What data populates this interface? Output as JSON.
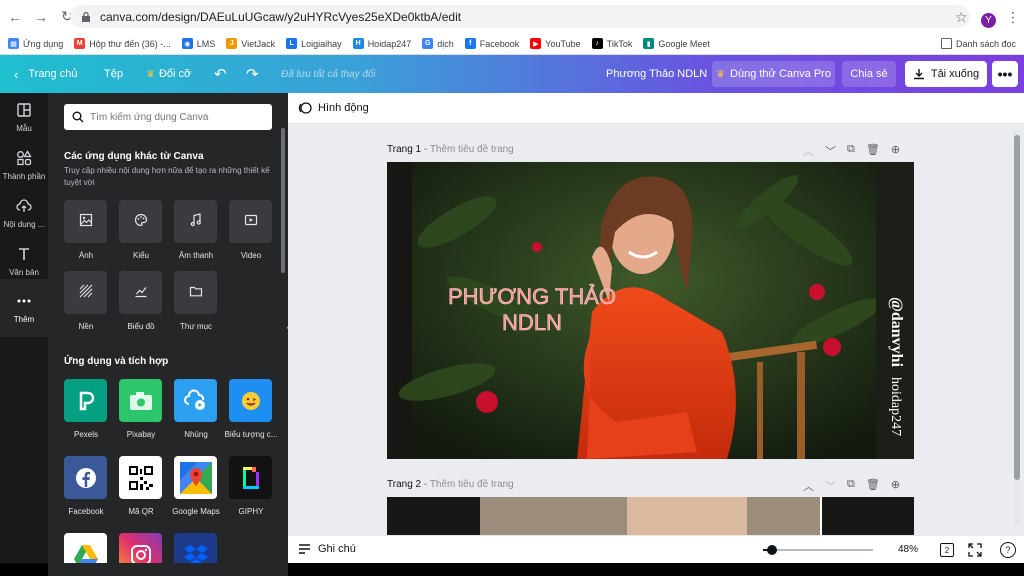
{
  "browser": {
    "url": "canva.com/design/DAEuLuUGcaw/y2uHYRcVyes25eXDe0ktbA/edit",
    "profile_initial": "Y",
    "bookmarks": [
      {
        "label": "Ứng dụng",
        "color": "#4285f4",
        "glyph": "▦"
      },
      {
        "label": "Hộp thư đến (36) -...",
        "color": "#ea4335",
        "glyph": "M"
      },
      {
        "label": "LMS",
        "color": "#1a73e8",
        "glyph": "◉"
      },
      {
        "label": "VietJack",
        "color": "#f29900",
        "glyph": "J"
      },
      {
        "label": "Loigiaihay",
        "color": "#1a73e8",
        "glyph": "L"
      },
      {
        "label": "Hoidap247",
        "color": "#1e88e5",
        "glyph": "H"
      },
      {
        "label": "dịch",
        "color": "#4285f4",
        "glyph": "G"
      },
      {
        "label": "Facebook",
        "color": "#1877f2",
        "glyph": "f"
      },
      {
        "label": "YouTube",
        "color": "#ff0000",
        "glyph": "▶"
      },
      {
        "label": "TikTok",
        "color": "#000000",
        "glyph": "♪"
      },
      {
        "label": "Google Meet",
        "color": "#00897b",
        "glyph": "▮"
      }
    ],
    "reading_list": "Danh sách đọc"
  },
  "header": {
    "home": "Trang chủ",
    "file": "Tệp",
    "resize": "Đổi cỡ",
    "saved": "Đã lưu tất cả thay đổi",
    "title": "Phương Thảo NDLN",
    "try_pro": "Dùng thử Canva Pro",
    "share": "Chia sẻ",
    "download": "Tải xuống"
  },
  "rail": [
    {
      "label": "Mẫu",
      "icon": "layout-icon"
    },
    {
      "label": "Thành phần",
      "icon": "shapes-icon"
    },
    {
      "label": "Nội dung ...",
      "icon": "upload-cloud-icon"
    },
    {
      "label": "Văn bản",
      "icon": "text-icon"
    },
    {
      "label": "Thêm",
      "icon": "more-icon"
    }
  ],
  "panel": {
    "search_placeholder": "Tìm kiếm ứng dụng Canva",
    "section1_title": "Các ứng dụng khác từ Canva",
    "section1_sub": "Truy cập nhiều nội dung hơn nữa để tạo ra những thiết kế tuyệt vời",
    "tools": [
      {
        "label": "Ảnh"
      },
      {
        "label": "Kiểu"
      },
      {
        "label": "Âm thanh"
      },
      {
        "label": "Video"
      },
      {
        "label": "Nền"
      },
      {
        "label": "Biểu đồ"
      },
      {
        "label": "Thư mục"
      }
    ],
    "section2_title": "Ứng dụng và tích hợp",
    "apps": [
      {
        "label": "Pexels",
        "color": "#05a081"
      },
      {
        "label": "Pixabay",
        "color": "#2ec66d"
      },
      {
        "label": "Nhúng",
        "color": "#2d9ff0"
      },
      {
        "label": "Biểu tượng c...",
        "color": "#1f8ef1"
      },
      {
        "label": "Facebook",
        "color": "#3b5998"
      },
      {
        "label": "Mã QR",
        "color": "#ffffff"
      },
      {
        "label": "Google Maps",
        "color": "#ffffff"
      },
      {
        "label": "GIPHY",
        "color": "#121212"
      }
    ]
  },
  "toolbar": {
    "animate": "Hình động"
  },
  "pages": [
    {
      "label": "Trang 1",
      "sub": "Thêm tiêu đề trang",
      "headline": "PHƯƠNG THẢO NDLN",
      "side_name": "@danvyhi",
      "side_site": "hoidap247"
    },
    {
      "label": "Trang 2",
      "sub": "Thêm tiêu đề trang"
    }
  ],
  "footer": {
    "notes": "Ghi chú",
    "zoom": "48%",
    "zoom_level": 0.08,
    "page_count": "2",
    "help": "?"
  }
}
